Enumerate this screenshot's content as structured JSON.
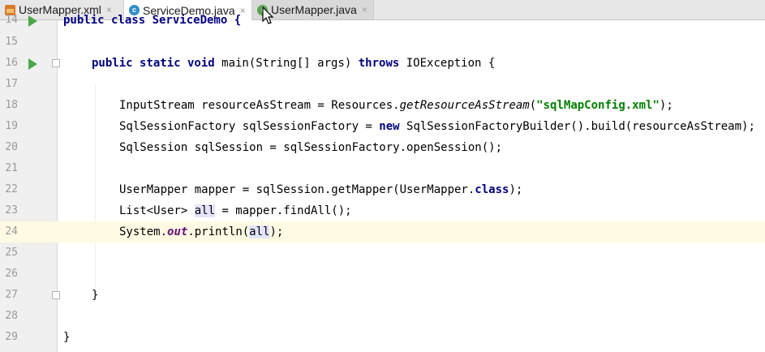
{
  "tabs": [
    {
      "label": "UserMapper.xml",
      "icon": "xml-file-icon"
    },
    {
      "label": "ServiceDemo.java",
      "icon": "java-class-icon"
    },
    {
      "label": "UserMapper.java",
      "icon": "java-interface-icon"
    }
  ],
  "close_glyph": "×",
  "code_lines": [
    {
      "no": "14",
      "text": "public class ServiceDemo {"
    },
    {
      "no": "15",
      "text": ""
    },
    {
      "no": "16",
      "kw1": "public static void",
      "mid": " main(String[] args) ",
      "kw2": "throws",
      "end": " IOException {"
    },
    {
      "no": "17",
      "text": ""
    },
    {
      "no": "18",
      "a": "InputStream resourceAsStream = Resources.",
      "method": "getResourceAsStream",
      "b": "(",
      "str": "\"sqlMapConfig.xml\"",
      "c": ");"
    },
    {
      "no": "19",
      "a": "SqlSessionFactory sqlSessionFactory = ",
      "kw": "new",
      "b": " SqlSessionFactoryBuilder().build(resourceAsStream);"
    },
    {
      "no": "20",
      "text": "SqlSession sqlSession = sqlSessionFactory.openSession();"
    },
    {
      "no": "21",
      "text": ""
    },
    {
      "no": "22",
      "a": "UserMapper mapper = sqlSession.getMapper(UserMapper.",
      "kw": "class",
      "b": ");"
    },
    {
      "no": "23",
      "a": "List<User> ",
      "var": "all",
      "b": " = mapper.findAll();"
    },
    {
      "no": "24",
      "a": "System.",
      "field": "out",
      "b": ".println(",
      "var": "all",
      "c": ");"
    },
    {
      "no": "25",
      "text": ""
    },
    {
      "no": "26",
      "text": ""
    },
    {
      "no": "27",
      "text": "}"
    },
    {
      "no": "28",
      "text": ""
    },
    {
      "no": "29",
      "text": "}"
    }
  ],
  "colors": {
    "keyword": "#000080",
    "string": "#008000",
    "static_field": "#660e7a",
    "current_line": "#fffae3",
    "run_gutter": "#4aa84a"
  }
}
